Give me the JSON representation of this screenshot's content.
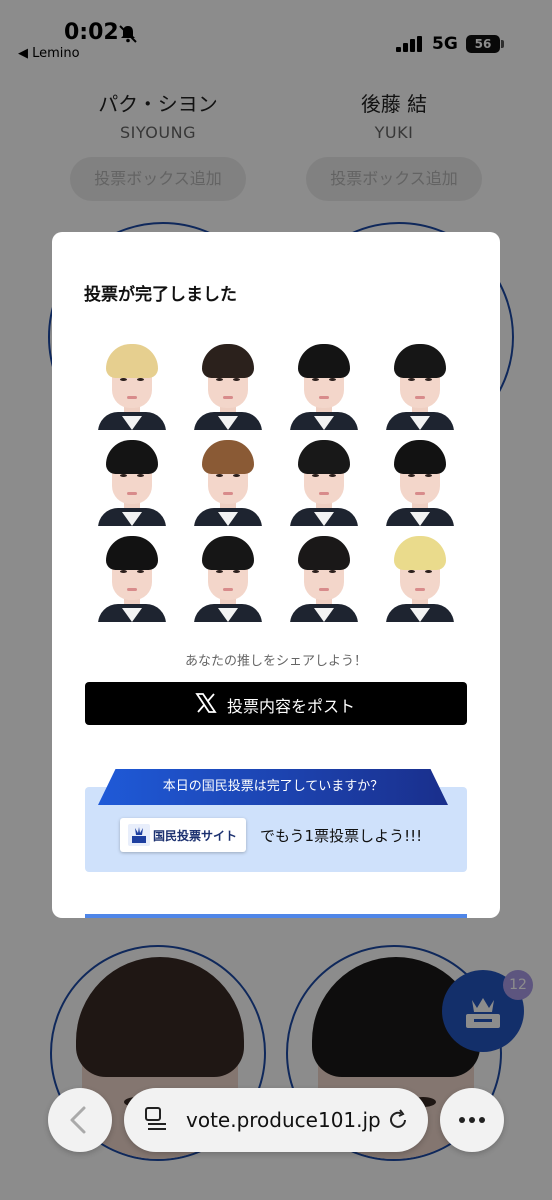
{
  "status_bar": {
    "time": "0:02",
    "back_app": "◀ Lemino",
    "network": "5G",
    "battery": "56"
  },
  "contestants": [
    {
      "name_jp": "パク・シヨン",
      "name_en": "SIYOUNG",
      "add_button": "投票ボックス追加"
    },
    {
      "name_jp": "後藤 結",
      "name_en": "YUKI",
      "add_button": "投票ボックス追加"
    }
  ],
  "modal": {
    "title": "投票が完了しました",
    "thumbnails": [
      {
        "hair": "#e6cf8f"
      },
      {
        "hair": "#2b211c"
      },
      {
        "hair": "#141414"
      },
      {
        "hair": "#161616"
      },
      {
        "hair": "#141414"
      },
      {
        "hair": "#8a5a35"
      },
      {
        "hair": "#181818"
      },
      {
        "hair": "#121212"
      },
      {
        "hair": "#121212"
      },
      {
        "hair": "#161616"
      },
      {
        "hair": "#1a1818"
      },
      {
        "hair": "#eadb8c"
      }
    ],
    "share_caption": "あなたの推しをシェアしよう！",
    "post_button": "投票内容をポスト",
    "ribbon_text": "本日の国民投票は完了していますか？",
    "site_button": "国民投票サイト",
    "vote_cta": "でもう1票投票しよう!!!"
  },
  "fab_badge": "12",
  "browser": {
    "url": "vote.produce101.jp"
  },
  "colors": {
    "accent_blue": "#2456c2",
    "circle_border": "#1c4aa6",
    "panel_blue": "#cfe1fb"
  }
}
